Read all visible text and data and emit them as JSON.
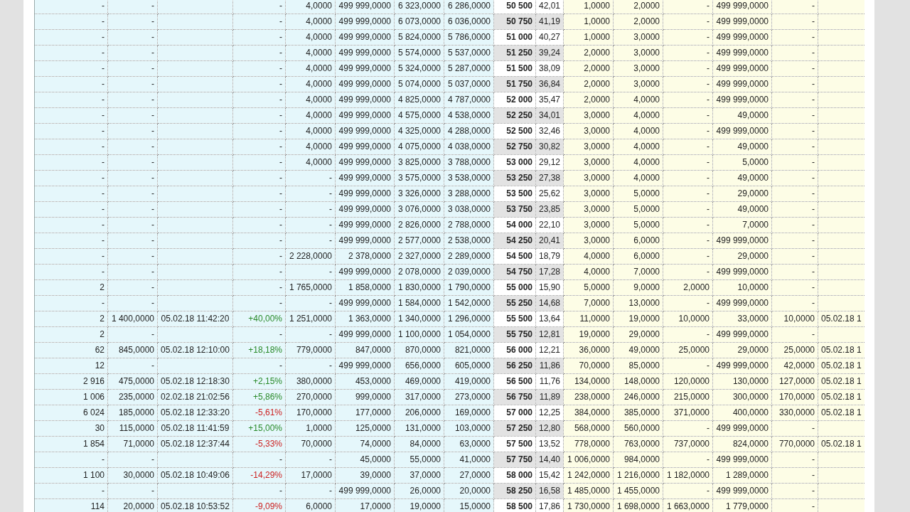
{
  "table": {
    "rows": [
      {
        "column_1": "-",
        "column_2": "-",
        "column_4": "-",
        "column_5": "4,0000",
        "column_6": "499 999,0000",
        "column_7": "6 323,0000",
        "column_8": "6 286,0000",
        "column_9": "50 500",
        "column_10": "42,01",
        "column_11": "1,0000",
        "column_12": "2,0000",
        "column_13": "-",
        "column_14": "499 999,0000",
        "column_15": "-"
      },
      {
        "column_1": "-",
        "column_2": "-",
        "column_4": "-",
        "column_5": "4,0000",
        "column_6": "499 999,0000",
        "column_7": "6 073,0000",
        "column_8": "6 036,0000",
        "column_9": "50 750",
        "column_10": "41,19",
        "column_11": "1,0000",
        "column_12": "2,0000",
        "column_13": "-",
        "column_14": "499 999,0000",
        "column_15": "-"
      },
      {
        "column_1": "-",
        "column_2": "-",
        "column_4": "-",
        "column_5": "4,0000",
        "column_6": "499 999,0000",
        "column_7": "5 824,0000",
        "column_8": "5 786,0000",
        "column_9": "51 000",
        "column_10": "40,27",
        "column_11": "1,0000",
        "column_12": "3,0000",
        "column_13": "-",
        "column_14": "499 999,0000",
        "column_15": "-"
      },
      {
        "column_1": "-",
        "column_2": "-",
        "column_4": "-",
        "column_5": "4,0000",
        "column_6": "499 999,0000",
        "column_7": "5 574,0000",
        "column_8": "5 537,0000",
        "column_9": "51 250",
        "column_10": "39,24",
        "column_11": "2,0000",
        "column_12": "3,0000",
        "column_13": "-",
        "column_14": "499 999,0000",
        "column_15": "-"
      },
      {
        "column_1": "-",
        "column_2": "-",
        "column_4": "-",
        "column_5": "4,0000",
        "column_6": "499 999,0000",
        "column_7": "5 324,0000",
        "column_8": "5 287,0000",
        "column_9": "51 500",
        "column_10": "38,09",
        "column_11": "2,0000",
        "column_12": "3,0000",
        "column_13": "-",
        "column_14": "499 999,0000",
        "column_15": "-"
      },
      {
        "column_1": "-",
        "column_2": "-",
        "column_4": "-",
        "column_5": "4,0000",
        "column_6": "499 999,0000",
        "column_7": "5 074,0000",
        "column_8": "5 037,0000",
        "column_9": "51 750",
        "column_10": "36,84",
        "column_11": "2,0000",
        "column_12": "3,0000",
        "column_13": "-",
        "column_14": "499 999,0000",
        "column_15": "-"
      },
      {
        "column_1": "-",
        "column_2": "-",
        "column_4": "-",
        "column_5": "4,0000",
        "column_6": "499 999,0000",
        "column_7": "4 825,0000",
        "column_8": "4 787,0000",
        "column_9": "52 000",
        "column_10": "35,47",
        "column_11": "2,0000",
        "column_12": "4,0000",
        "column_13": "-",
        "column_14": "499 999,0000",
        "column_15": "-"
      },
      {
        "column_1": "-",
        "column_2": "-",
        "column_4": "-",
        "column_5": "4,0000",
        "column_6": "499 999,0000",
        "column_7": "4 575,0000",
        "column_8": "4 538,0000",
        "column_9": "52 250",
        "column_10": "34,01",
        "column_11": "3,0000",
        "column_12": "4,0000",
        "column_13": "-",
        "column_14": "49,0000",
        "column_15": "-"
      },
      {
        "column_1": "-",
        "column_2": "-",
        "column_4": "-",
        "column_5": "4,0000",
        "column_6": "499 999,0000",
        "column_7": "4 325,0000",
        "column_8": "4 288,0000",
        "column_9": "52 500",
        "column_10": "32,46",
        "column_11": "3,0000",
        "column_12": "4,0000",
        "column_13": "-",
        "column_14": "499 999,0000",
        "column_15": "-"
      },
      {
        "column_1": "-",
        "column_2": "-",
        "column_4": "-",
        "column_5": "4,0000",
        "column_6": "499 999,0000",
        "column_7": "4 075,0000",
        "column_8": "4 038,0000",
        "column_9": "52 750",
        "column_10": "30,82",
        "column_11": "3,0000",
        "column_12": "4,0000",
        "column_13": "-",
        "column_14": "49,0000",
        "column_15": "-"
      },
      {
        "column_1": "-",
        "column_2": "-",
        "column_4": "-",
        "column_5": "4,0000",
        "column_6": "499 999,0000",
        "column_7": "3 825,0000",
        "column_8": "3 788,0000",
        "column_9": "53 000",
        "column_10": "29,12",
        "column_11": "3,0000",
        "column_12": "4,0000",
        "column_13": "-",
        "column_14": "5,0000",
        "column_15": "-"
      },
      {
        "column_1": "-",
        "column_2": "-",
        "column_4": "-",
        "column_5": "-",
        "column_6": "499 999,0000",
        "column_7": "3 575,0000",
        "column_8": "3 538,0000",
        "column_9": "53 250",
        "column_10": "27,38",
        "column_11": "3,0000",
        "column_12": "4,0000",
        "column_13": "-",
        "column_14": "49,0000",
        "column_15": "-"
      },
      {
        "column_1": "-",
        "column_2": "-",
        "column_4": "-",
        "column_5": "-",
        "column_6": "499 999,0000",
        "column_7": "3 326,0000",
        "column_8": "3 288,0000",
        "column_9": "53 500",
        "column_10": "25,62",
        "column_11": "3,0000",
        "column_12": "5,0000",
        "column_13": "-",
        "column_14": "29,0000",
        "column_15": "-"
      },
      {
        "column_1": "-",
        "column_2": "-",
        "column_4": "-",
        "column_5": "-",
        "column_6": "499 999,0000",
        "column_7": "3 076,0000",
        "column_8": "3 038,0000",
        "column_9": "53 750",
        "column_10": "23,85",
        "column_11": "3,0000",
        "column_12": "5,0000",
        "column_13": "-",
        "column_14": "49,0000",
        "column_15": "-"
      },
      {
        "column_1": "-",
        "column_2": "-",
        "column_4": "-",
        "column_5": "-",
        "column_6": "499 999,0000",
        "column_7": "2 826,0000",
        "column_8": "2 788,0000",
        "column_9": "54 000",
        "column_10": "22,10",
        "column_11": "3,0000",
        "column_12": "5,0000",
        "column_13": "-",
        "column_14": "7,0000",
        "column_15": "-"
      },
      {
        "column_1": "-",
        "column_2": "-",
        "column_4": "-",
        "column_5": "-",
        "column_6": "499 999,0000",
        "column_7": "2 577,0000",
        "column_8": "2 538,0000",
        "column_9": "54 250",
        "column_10": "20,41",
        "column_11": "3,0000",
        "column_12": "6,0000",
        "column_13": "-",
        "column_14": "499 999,0000",
        "column_15": "-"
      },
      {
        "column_1": "-",
        "column_2": "-",
        "column_4": "-",
        "column_5": "2 228,0000",
        "column_6": "2 378,0000",
        "column_7": "2 327,0000",
        "column_8": "2 289,0000",
        "column_9": "54 500",
        "column_10": "18,79",
        "column_11": "4,0000",
        "column_12": "6,0000",
        "column_13": "-",
        "column_14": "29,0000",
        "column_15": "-"
      },
      {
        "column_1": "-",
        "column_2": "-",
        "column_4": "-",
        "column_5": "-",
        "column_6": "499 999,0000",
        "column_7": "2 078,0000",
        "column_8": "2 039,0000",
        "column_9": "54 750",
        "column_10": "17,28",
        "column_11": "4,0000",
        "column_12": "7,0000",
        "column_13": "-",
        "column_14": "499 999,0000",
        "column_15": "-"
      },
      {
        "column_1": "2",
        "column_2": "-",
        "column_4": "-",
        "column_5": "1 765,0000",
        "column_6": "1 858,0000",
        "column_7": "1 830,0000",
        "column_8": "1 790,0000",
        "column_9": "55 000",
        "column_10": "15,90",
        "column_11": "5,0000",
        "column_12": "9,0000",
        "column_13": "2,0000",
        "column_14": "10,0000",
        "column_15": "-"
      },
      {
        "column_1": "-",
        "column_2": "-",
        "column_4": "-",
        "column_5": "-",
        "column_6": "499 999,0000",
        "column_7": "1 584,0000",
        "column_8": "1 542,0000",
        "column_9": "55 250",
        "column_10": "14,68",
        "column_11": "7,0000",
        "column_12": "13,0000",
        "column_13": "-",
        "column_14": "499 999,0000",
        "column_15": "-"
      },
      {
        "column_1": "2",
        "column_2": "1 400,0000",
        "column_3": "05.02.18 11:42:20",
        "column_4": "+40,00%",
        "color": "#2a8a2a",
        "column_5": "1 251,0000",
        "column_6": "1 363,0000",
        "column_7": "1 340,0000",
        "column_8": "1 296,0000",
        "column_9": "55 500",
        "column_10": "13,64",
        "column_11": "11,0000",
        "column_12": "19,0000",
        "column_13": "10,0000",
        "column_14": "33,0000",
        "column_15": "10,0000",
        "column_16": "05.02.18 1"
      },
      {
        "column_1": "2",
        "column_2": "-",
        "column_4": "-",
        "column_5": "-",
        "column_6": "499 999,0000",
        "column_7": "1 100,0000",
        "column_8": "1 054,0000",
        "column_9": "55 750",
        "column_10": "12,81",
        "column_11": "19,0000",
        "column_12": "29,0000",
        "column_13": "-",
        "column_14": "499 999,0000",
        "column_15": "-"
      },
      {
        "column_1": "62",
        "column_2": "845,0000",
        "column_3": "05.02.18 12:10:00",
        "column_4": "+18,18%",
        "color": "#2a8a2a",
        "column_5": "779,0000",
        "column_6": "847,0000",
        "column_7": "870,0000",
        "column_8": "821,0000",
        "column_9": "56 000",
        "column_10": "12,21",
        "column_11": "36,0000",
        "column_12": "49,0000",
        "column_13": "25,0000",
        "column_14": "29,0000",
        "column_15": "25,0000",
        "column_16": "05.02.18 1"
      },
      {
        "column_1": "12",
        "column_2": "-",
        "column_4": "-",
        "column_5": "-",
        "column_6": "499 999,0000",
        "column_7": "656,0000",
        "column_8": "605,0000",
        "column_9": "56 250",
        "column_10": "11,86",
        "column_11": "70,0000",
        "column_12": "85,0000",
        "column_13": "-",
        "column_14": "499 999,0000",
        "column_15": "42,0000",
        "column_16": "05.02.18 1"
      },
      {
        "column_1": "2 916",
        "column_2": "475,0000",
        "column_3": "05.02.18 12:18:30",
        "column_4": "+2,15%",
        "color": "#2a8a2a",
        "column_5": "380,0000",
        "column_6": "453,0000",
        "column_7": "469,0000",
        "column_8": "419,0000",
        "column_9": "56 500",
        "column_10": "11,76",
        "column_11": "134,0000",
        "column_12": "148,0000",
        "column_13": "120,0000",
        "column_14": "130,0000",
        "column_15": "127,0000",
        "column_16": "05.02.18 1"
      },
      {
        "column_1": "1 006",
        "column_2": "235,0000",
        "column_3": "02.02.18 21:02:56",
        "column_4": "+5,86%",
        "color": "#2a8a2a",
        "column_5": "270,0000",
        "column_6": "999,0000",
        "column_7": "317,0000",
        "column_8": "273,0000",
        "column_9": "56 750",
        "column_10": "11,89",
        "column_11": "238,0000",
        "column_12": "246,0000",
        "column_13": "215,0000",
        "column_14": "300,0000",
        "column_15": "170,0000",
        "column_16": "05.02.18 1"
      },
      {
        "column_1": "6 024",
        "column_2": "185,0000",
        "column_3": "05.02.18 12:33:20",
        "column_4": "-5,61%",
        "color": "#cc2222",
        "column_5": "170,0000",
        "column_6": "177,0000",
        "column_7": "206,0000",
        "column_8": "169,0000",
        "column_9": "57 000",
        "column_10": "12,25",
        "column_11": "384,0000",
        "column_12": "385,0000",
        "column_13": "371,0000",
        "column_14": "400,0000",
        "column_15": "330,0000",
        "column_16": "05.02.18 1"
      },
      {
        "column_1": "30",
        "column_2": "115,0000",
        "column_3": "05.02.18 11:41:59",
        "column_4": "+15,00%",
        "color": "#2a8a2a",
        "column_5": "1,0000",
        "column_6": "125,0000",
        "column_7": "131,0000",
        "column_8": "103,0000",
        "column_9": "57 250",
        "column_10": "12,80",
        "column_11": "568,0000",
        "column_12": "560,0000",
        "column_13": "-",
        "column_14": "499 999,0000",
        "column_15": "-"
      },
      {
        "column_1": "1 854",
        "column_2": "71,0000",
        "column_3": "05.02.18 12:37:44",
        "column_4": "-5,33%",
        "color": "#cc2222",
        "column_5": "70,0000",
        "column_6": "74,0000",
        "column_7": "84,0000",
        "column_8": "63,0000",
        "column_9": "57 500",
        "column_10": "13,52",
        "column_11": "778,0000",
        "column_12": "763,0000",
        "column_13": "737,0000",
        "column_14": "824,0000",
        "column_15": "770,0000",
        "column_16": "05.02.18 1"
      },
      {
        "column_1": "-",
        "column_2": "-",
        "column_4": "-",
        "column_5": "-",
        "column_6": "45,0000",
        "column_7": "55,0000",
        "column_8": "41,0000",
        "column_9": "57 750",
        "column_10": "14,40",
        "column_11": "1 006,0000",
        "column_12": "984,0000",
        "column_13": "-",
        "column_14": "499 999,0000",
        "column_15": "-"
      },
      {
        "column_1": "1 100",
        "column_2": "30,0000",
        "column_3": "05.02.18 10:49:06",
        "column_4": "-14,29%",
        "color": "#cc2222",
        "column_5": "17,0000",
        "column_6": "39,0000",
        "column_7": "37,0000",
        "column_8": "27,0000",
        "column_9": "58 000",
        "column_10": "15,42",
        "column_11": "1 242,0000",
        "column_12": "1 216,0000",
        "column_13": "1 182,0000",
        "column_14": "1 289,0000",
        "column_15": "-"
      },
      {
        "column_1": "-",
        "column_2": "-",
        "column_4": "-",
        "column_5": "-",
        "column_6": "499 999,0000",
        "column_7": "26,0000",
        "column_8": "20,0000",
        "column_9": "58 250",
        "column_10": "16,58",
        "column_11": "1 485,0000",
        "column_12": "1 455,0000",
        "column_13": "-",
        "column_14": "499 999,0000",
        "column_15": "-"
      },
      {
        "column_1": "114",
        "column_2": "20,0000",
        "column_3": "05.02.18 10:53:52",
        "column_4": "-9,09%",
        "color": "#cc2222",
        "column_5": "6,0000",
        "column_6": "17,0000",
        "column_7": "19,0000",
        "column_8": "15,0000",
        "column_9": "58 500",
        "column_10": "17,86",
        "column_11": "1 730,0000",
        "column_12": "1 698,0000",
        "column_13": "1 663,0000",
        "column_14": "1 779,0000",
        "column_15": "-"
      }
    ]
  }
}
